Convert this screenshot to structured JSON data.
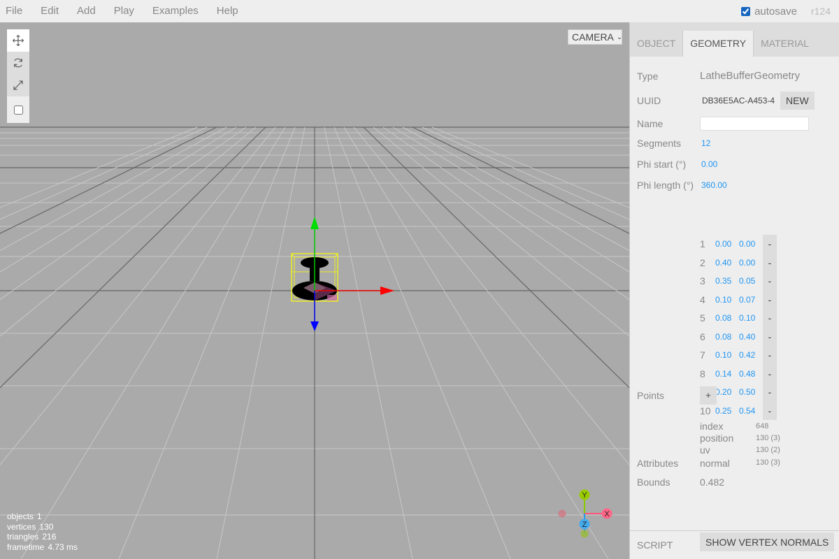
{
  "menubar": {
    "items": [
      "File",
      "Edit",
      "Add",
      "Play",
      "Examples",
      "Help"
    ],
    "autosave_label": "autosave",
    "autosave_checked": true,
    "version": "r124"
  },
  "toolbar": {
    "tools": [
      {
        "name": "translate",
        "icon": "move-icon",
        "selected": true
      },
      {
        "name": "rotate",
        "icon": "rotate-icon",
        "selected": false
      },
      {
        "name": "scale",
        "icon": "scale-icon",
        "selected": false
      }
    ],
    "local_checked": false
  },
  "viewport": {
    "camera_select": "CAMERA",
    "info": [
      {
        "label": "objects",
        "value": "1"
      },
      {
        "label": "vertices",
        "value": "130"
      },
      {
        "label": "triangles",
        "value": "216"
      },
      {
        "label": "frametime",
        "value": "4.73 ms"
      }
    ],
    "axes_helper": {
      "y": "Y",
      "x": "X",
      "z": "Z"
    }
  },
  "sidebar": {
    "tabs": [
      {
        "label": "OBJECT",
        "selected": false
      },
      {
        "label": "GEOMETRY",
        "selected": true
      },
      {
        "label": "MATERIAL",
        "selected": false
      }
    ],
    "geometry": {
      "type_label": "Type",
      "type_value": "LatheBufferGeometry",
      "uuid_label": "UUID",
      "uuid_value": "DB36E5AC-A453-4",
      "new_button": "NEW",
      "name_label": "Name",
      "name_value": "",
      "segments_label": "Segments",
      "segments_value": "12",
      "phi_start_label": "Phi start (°)",
      "phi_start_value": "0.00",
      "phi_length_label": "Phi length (°)",
      "phi_length_value": "360.00",
      "points_label": "Points",
      "points": [
        {
          "index": "1",
          "x": "0.00",
          "y": "0.00"
        },
        {
          "index": "2",
          "x": "0.40",
          "y": "0.00"
        },
        {
          "index": "3",
          "x": "0.35",
          "y": "0.05"
        },
        {
          "index": "4",
          "x": "0.10",
          "y": "0.07"
        },
        {
          "index": "5",
          "x": "0.08",
          "y": "0.10"
        },
        {
          "index": "6",
          "x": "0.08",
          "y": "0.40"
        },
        {
          "index": "7",
          "x": "0.10",
          "y": "0.42"
        },
        {
          "index": "8",
          "x": "0.14",
          "y": "0.48"
        },
        {
          "index": "9",
          "x": "0.20",
          "y": "0.50"
        },
        {
          "index": "10",
          "x": "0.25",
          "y": "0.54"
        }
      ],
      "delete_label": "-",
      "add_label": "+",
      "attributes_label": "Attributes",
      "attributes": [
        {
          "name": "index",
          "value": "648"
        },
        {
          "name": "position",
          "value": "130 (3)"
        },
        {
          "name": "uv",
          "value": "130 (2)"
        },
        {
          "name": "normal",
          "value": "130 (3)"
        }
      ],
      "bounds_label": "Bounds",
      "bounds_value": "0.482",
      "show_normals_button": "SHOW VERTEX NORMALS"
    },
    "script_label": "SCRIPT"
  }
}
